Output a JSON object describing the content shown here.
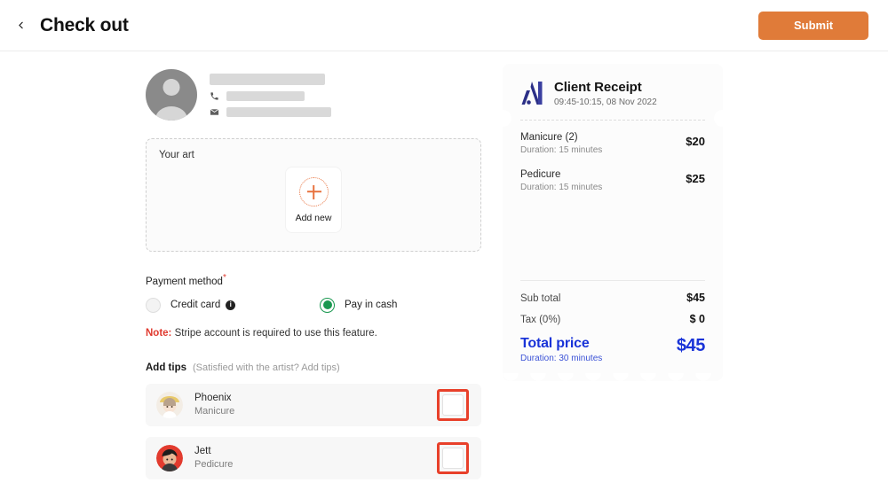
{
  "header": {
    "back_icon": "chevron-left-icon",
    "title": "Check out",
    "submit_label": "Submit"
  },
  "client": {
    "avatar_icon": "user-avatar-placeholder",
    "name_redacted": "",
    "phone_icon": "phone-icon",
    "phone_redacted": "",
    "email_icon": "mail-icon",
    "email_redacted": ""
  },
  "art": {
    "label": "Your art",
    "add_new_label": "Add new",
    "plus_icon": "plus-icon",
    "accent_color": "#e8733f"
  },
  "payment": {
    "label": "Payment method",
    "required_mark": "*",
    "options": [
      {
        "label": "Credit card",
        "selected": false,
        "info_icon": "info-icon",
        "info_glyph": "i"
      },
      {
        "label": "Pay in cash",
        "selected": true
      }
    ],
    "note_label": "Note:",
    "note_text": " Stripe account is required to use this feature.",
    "selected_color": "#1a9850"
  },
  "tips": {
    "title": "Add tips",
    "subtitle": "(Satisfied with the artist? Add tips)",
    "highlight_color": "#e8402a",
    "rows": [
      {
        "name": "Phoenix",
        "service": "Manicure",
        "avatar": "phoenix-avatar",
        "tip_value": ""
      },
      {
        "name": "Jett",
        "service": "Pedicure",
        "avatar": "jett-avatar",
        "tip_value": ""
      }
    ]
  },
  "receipt": {
    "logo_icon": "brand-logo-icon",
    "title": "Client Receipt",
    "datetime": "09:45-10:15, 08 Nov 2022",
    "items": [
      {
        "name": "Manicure (2)",
        "duration": "Duration: 15 minutes",
        "price": "$20"
      },
      {
        "name": "Pedicure",
        "duration": "Duration: 15 minutes",
        "price": "$25"
      }
    ],
    "subtotal_label": "Sub total",
    "subtotal_value": "$45",
    "tax_label": "Tax (0%)",
    "tax_value": "$ 0",
    "total_label": "Total price",
    "total_duration": "Duration: 30 minutes",
    "total_value": "$45",
    "accent_color": "#1a34d8"
  }
}
